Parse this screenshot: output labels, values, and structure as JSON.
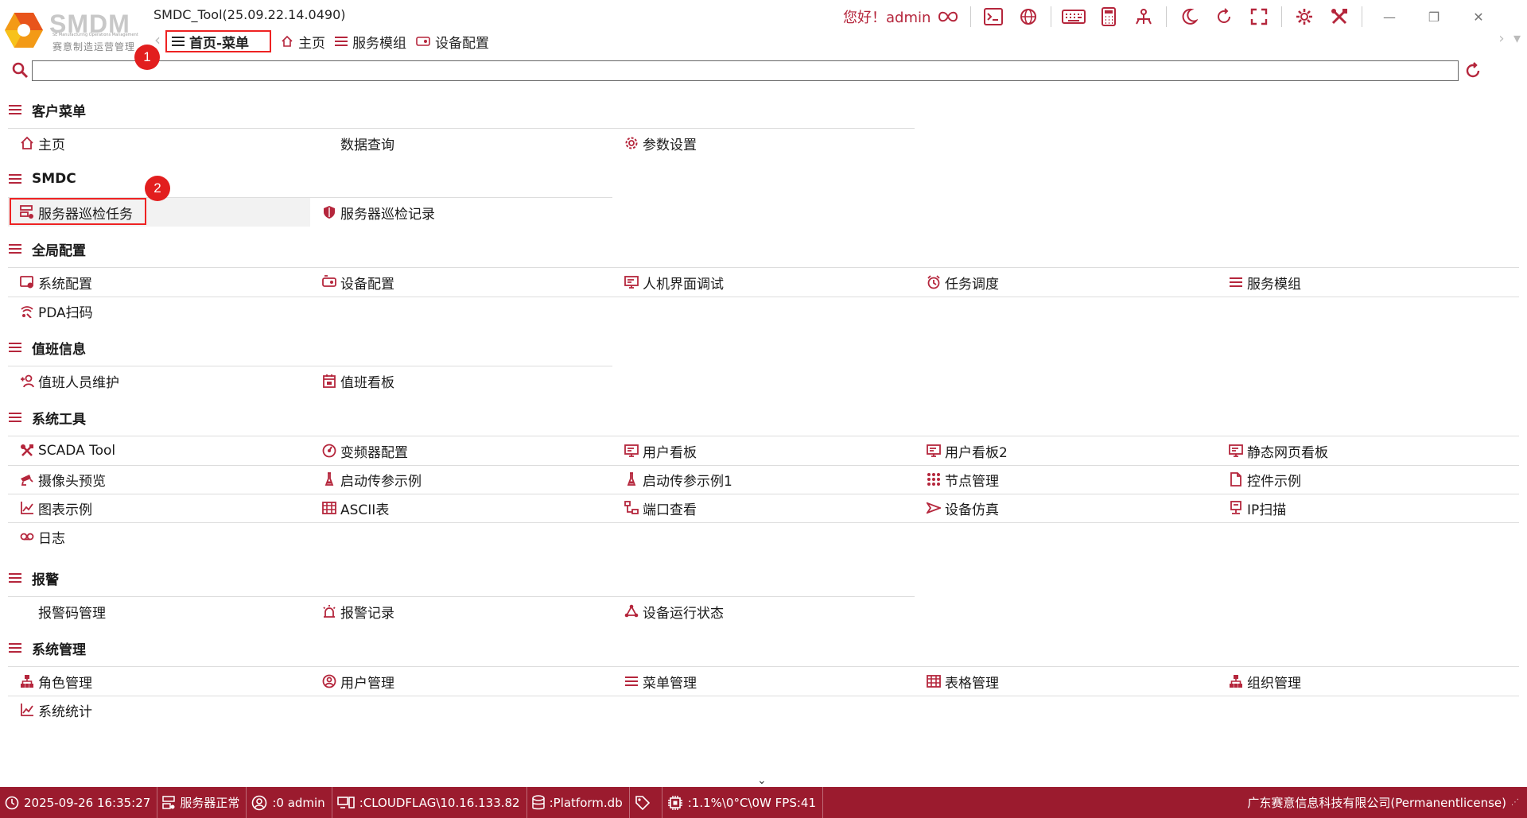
{
  "window": {
    "title": "SMDC_Tool(25.09.22.14.0490)",
    "logo_text": "SMDM",
    "logo_subtitle": "赛意制造运营管理",
    "logo_tagline": "SE Manufacturing Operations Management"
  },
  "header": {
    "greeting": "您好！admin"
  },
  "tabs": [
    {
      "label": "首页-菜单",
      "icon": "menu-icon"
    },
    {
      "label": "主页",
      "icon": "home-icon"
    },
    {
      "label": "服务模组",
      "icon": "menu-icon"
    },
    {
      "label": "设备配置",
      "icon": "device-icon"
    }
  ],
  "search": {
    "value": "",
    "placeholder": ""
  },
  "groups": [
    {
      "title": "客户菜单",
      "items": [
        {
          "label": "主页",
          "icon": "home-icon"
        },
        {
          "label": "数据查询",
          "icon": ""
        },
        {
          "label": "参数设置",
          "icon": "gear-icon"
        }
      ]
    },
    {
      "title": "SMDC",
      "items": [
        {
          "label": "服务器巡检任务",
          "icon": "server-icon"
        },
        {
          "label": "服务器巡检记录",
          "icon": "shield-icon"
        }
      ]
    },
    {
      "title": "全局配置",
      "items": [
        {
          "label": "系统配置",
          "icon": "system-config-icon"
        },
        {
          "label": "设备配置",
          "icon": "device-icon"
        },
        {
          "label": "人机界面调试",
          "icon": "monitor-icon"
        },
        {
          "label": "任务调度",
          "icon": "alarm-clock-icon"
        },
        {
          "label": "服务模组",
          "icon": "menu-icon"
        },
        {
          "label": "PDA扫码",
          "icon": "wifi-scan-icon"
        }
      ]
    },
    {
      "title": "值班信息",
      "items": [
        {
          "label": "值班人员维护",
          "icon": "add-user-icon"
        },
        {
          "label": "值班看板",
          "icon": "calendar-icon"
        }
      ]
    },
    {
      "title": "系统工具",
      "items": [
        {
          "label": "SCADA Tool",
          "icon": "tools-icon"
        },
        {
          "label": "变频器配置",
          "icon": "dial-icon"
        },
        {
          "label": "用户看板",
          "icon": "monitor-icon"
        },
        {
          "label": "用户看板2",
          "icon": "monitor-icon"
        },
        {
          "label": "静态网页看板",
          "icon": "monitor-icon"
        },
        {
          "label": "摄像头预览",
          "icon": "camera-icon"
        },
        {
          "label": "启动传参示例",
          "icon": "flask-icon"
        },
        {
          "label": "启动传参示例1",
          "icon": "flask-icon"
        },
        {
          "label": "节点管理",
          "icon": "grid-dots-icon"
        },
        {
          "label": "控件示例",
          "icon": "file-icon"
        },
        {
          "label": "图表示例",
          "icon": "line-chart-icon"
        },
        {
          "label": "ASCII表",
          "icon": "table-icon"
        },
        {
          "label": "端口查看",
          "icon": "network-icon"
        },
        {
          "label": "设备仿真",
          "icon": "send-icon"
        },
        {
          "label": "IP扫描",
          "icon": "ip-icon"
        },
        {
          "label": "日志",
          "icon": "voicemail-icon"
        }
      ]
    },
    {
      "title": "报警",
      "items": [
        {
          "label": "报警码管理",
          "icon": ""
        },
        {
          "label": "报警记录",
          "icon": "siren-icon"
        },
        {
          "label": "设备运行状态",
          "icon": "share-nodes-icon"
        }
      ]
    },
    {
      "title": "系统管理",
      "items": [
        {
          "label": "角色管理",
          "icon": "hierarchy-icon"
        },
        {
          "label": "用户管理",
          "icon": "user-circle-icon"
        },
        {
          "label": "菜单管理",
          "icon": "menu-icon"
        },
        {
          "label": "表格管理",
          "icon": "table-icon"
        },
        {
          "label": "组织管理",
          "icon": "hierarchy-icon"
        },
        {
          "label": "系统统计",
          "icon": "line-chart-icon"
        }
      ]
    }
  ],
  "annotations": [
    "1",
    "2"
  ],
  "status": {
    "datetime": "2025-09-26 16:35:27",
    "server": "服务器正常",
    "user": ":0 admin",
    "host": ":CLOUDFLAG\\10.16.133.82",
    "db": ":Platform.db",
    "perf": ":1.1%\\0°C\\0W  FPS:41",
    "company": "广东赛意信息科技有限公司(Permanentlicense)"
  },
  "colors": {
    "accent": "#b5263c",
    "statusbar": "#9b1b2e",
    "highlight_box": "#e22222"
  }
}
